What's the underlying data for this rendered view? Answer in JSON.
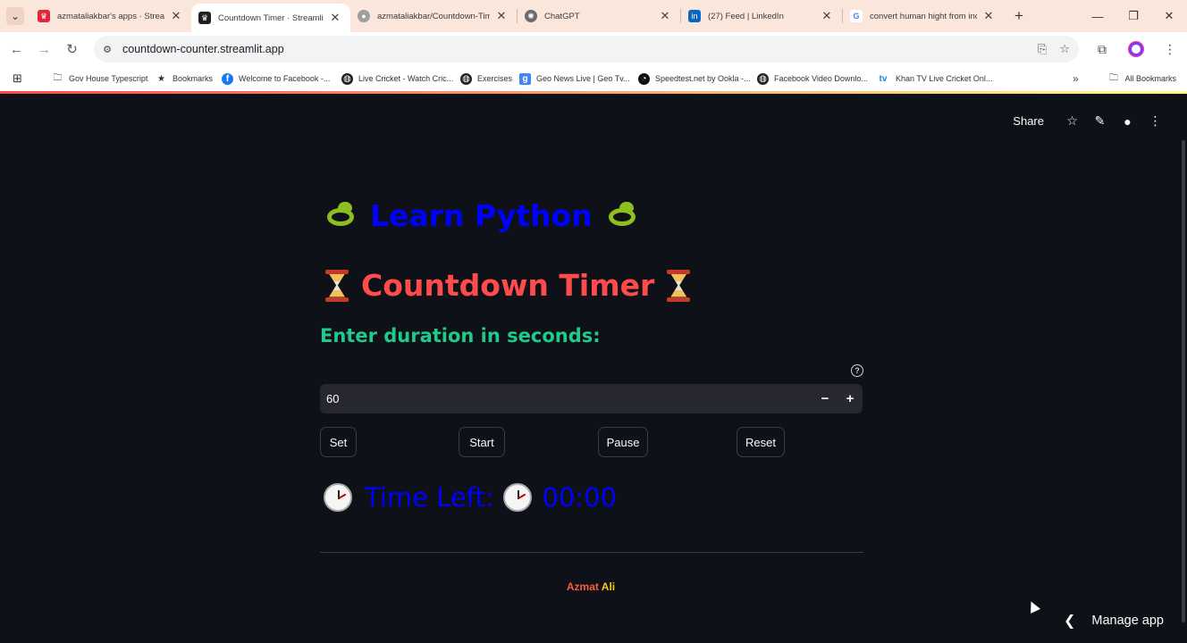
{
  "browser": {
    "tabs": [
      {
        "title": "azmataliakbar's apps · Streamlit",
        "favicon_color": "#e4253b",
        "active": false
      },
      {
        "title": "Countdown Timer · Streamlit",
        "favicon_color": "#1f1f1f",
        "active": true
      },
      {
        "title": "azmataliakbar/Countdown-Time",
        "favicon_color": "#9e9e9e",
        "active": false
      },
      {
        "title": "ChatGPT",
        "favicon_color": "#6b6b6b",
        "active": false
      },
      {
        "title": "(27) Feed | LinkedIn",
        "favicon_color": "#0a66c2",
        "active": false
      },
      {
        "title": "convert human hight from inch",
        "favicon_color": "#4285f4",
        "active": false
      }
    ],
    "url": "countdown-counter.streamlit.app",
    "bookmarks": [
      {
        "label": "Gov House Typescript",
        "icon": "folder-icon"
      },
      {
        "label": "Bookmarks",
        "icon": "star-icon"
      },
      {
        "label": "Welcome to Facebook -...",
        "icon": "facebook-icon"
      },
      {
        "label": "Live Cricket - Watch Cric...",
        "icon": "globe-icon"
      },
      {
        "label": "Exercises",
        "icon": "globe-icon"
      },
      {
        "label": "Geo News Live | Geo Tv...",
        "icon": "geo-icon"
      },
      {
        "label": "Speedtest.net by Ookla -...",
        "icon": "speedtest-icon"
      },
      {
        "label": "Facebook Video Downlo...",
        "icon": "globe-icon"
      },
      {
        "label": "Khan TV Live Cricket Onl...",
        "icon": "tv-icon"
      }
    ],
    "all_bookmarks": "All Bookmarks"
  },
  "app": {
    "header": {
      "share": "Share"
    },
    "title_python": "Learn Python",
    "title_timer": "Countdown Timer",
    "duration_label": "Enter duration in seconds:",
    "duration_value": "60",
    "buttons": {
      "set": "Set",
      "start": "Start",
      "pause": "Pause",
      "reset": "Reset"
    },
    "time_left_label": "Time Left:",
    "time_left_value": "00:00",
    "footer": {
      "part1": "Azmat",
      "part2": " Ali"
    },
    "manage_app": "Manage app"
  },
  "colors": {
    "background": "#0e1117",
    "python_title": "#0000ff",
    "timer_title": "#ff4b4b",
    "duration_label": "#21c98a",
    "time_left": "#0000ff",
    "footer_part1": "#ff5a3c",
    "footer_part2": "#f5c518"
  }
}
